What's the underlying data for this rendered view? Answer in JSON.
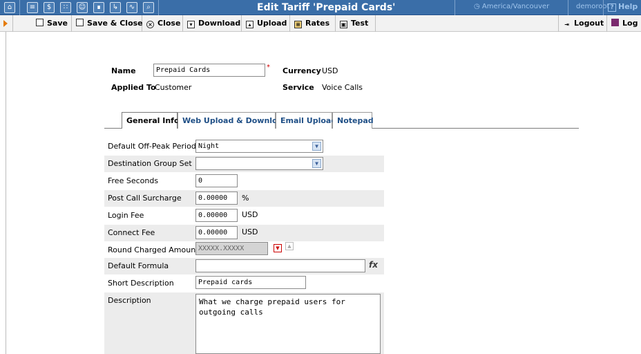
{
  "window": {
    "title": "Edit Tariff 'Prepaid Cards'",
    "timezone": "America/Vancouver",
    "user": "demoroot",
    "help_label": "Help"
  },
  "toolbar": {
    "save": "Save",
    "save_close": "Save & Close",
    "close": "Close",
    "download": "Download",
    "upload": "Upload",
    "rates": "Rates",
    "test": "Test",
    "logout": "Logout",
    "log": "Log"
  },
  "header": {
    "name_label": "Name",
    "name_value": "Prepaid Cards",
    "applied_to_label": "Applied To",
    "applied_to_value": "Customer",
    "currency_label": "Currency",
    "currency_value": "USD",
    "service_label": "Service",
    "service_value": "Voice Calls"
  },
  "tabs": [
    {
      "label": "General Info",
      "active": true
    },
    {
      "label": "Web Upload & Download",
      "active": false
    },
    {
      "label": "Email Upload",
      "active": false
    },
    {
      "label": "Notepad",
      "active": false
    }
  ],
  "form": {
    "default_off_peak_label": "Default Off-Peak Period",
    "default_off_peak_value": "Night",
    "dest_group_set_label": "Destination Group Set",
    "dest_group_set_value": "",
    "free_seconds_label": "Free Seconds",
    "free_seconds_value": "0",
    "post_call_label": "Post Call Surcharge",
    "post_call_value": "0.00000",
    "post_call_unit": "%",
    "login_fee_label": "Login Fee",
    "login_fee_value": "0.00000",
    "login_fee_unit": "USD",
    "connect_fee_label": "Connect Fee",
    "connect_fee_value": "0.00000",
    "connect_fee_unit": "USD",
    "round_label": "Round Charged Amount",
    "round_value": "XXXXX.XXXXX",
    "default_formula_label": "Default Formula",
    "default_formula_value": "",
    "short_desc_label": "Short Description",
    "short_desc_value": "Prepaid cards",
    "description_label": "Description",
    "description_value": "What we charge prepaid users for\noutgoing calls"
  }
}
